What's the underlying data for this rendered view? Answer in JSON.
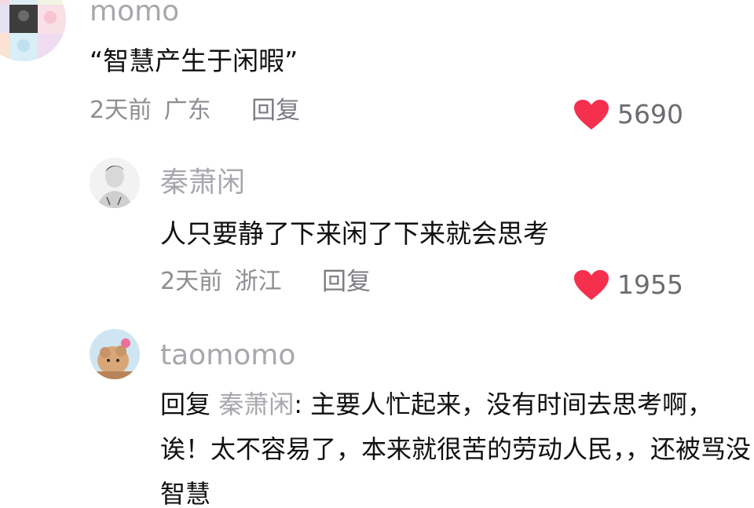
{
  "colors": {
    "username": "#a7a7ad",
    "body_text": "#111111",
    "meta_text": "#8e8e93",
    "heart": "#f5304e",
    "count": "#6b6b70"
  },
  "comments": [
    {
      "username": "momo",
      "text": "“智慧产生于闲暇”",
      "time": "2天前",
      "location": "广东",
      "reply_label": "回复",
      "likes": "5690",
      "avatar_icon": "cartoon-grid-avatar-icon"
    },
    {
      "username": "秦萧闲",
      "text": "人只要静了下来闲了下来就会思考",
      "time": "2天前",
      "location": "浙江",
      "reply_label": "回复",
      "likes": "1955",
      "avatar_icon": "person-photo-avatar-icon"
    },
    {
      "username": "taomomo",
      "reply_prefix": "回复",
      "reply_to": "秦萧闲",
      "text": ": 主要人忙起来，没有时间去思考啊，诶！太不容易了，本来就很苦的劳动人民，，还被骂没智慧",
      "avatar_icon": "plush-toy-avatar-icon"
    }
  ]
}
